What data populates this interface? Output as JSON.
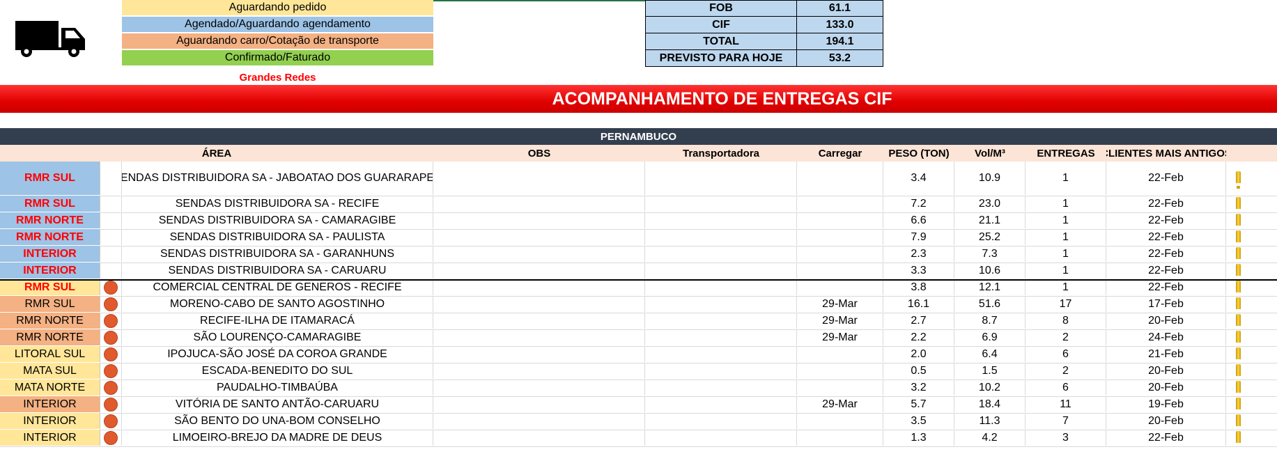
{
  "legend": [
    {
      "label": "Aguardando pedido",
      "color": "#ffe699"
    },
    {
      "label": "Agendado/Aguardando agendamento",
      "color": "#9dc3e6"
    },
    {
      "label": "Aguardando carro/Cotação de transporte",
      "color": "#f4b183"
    },
    {
      "label": "Confirmado/Faturado",
      "color": "#92d050"
    }
  ],
  "legend_note": "Grandes Redes",
  "summary": [
    {
      "label": "FOB",
      "value": "61.1"
    },
    {
      "label": "CIF",
      "value": "133.0"
    },
    {
      "label": "TOTAL",
      "value": "194.1"
    },
    {
      "label": "PREVISTO PARA HOJE",
      "value": "53.2"
    }
  ],
  "title": "ACOMPANHAMENTO DE ENTREGAS CIF",
  "region": "PERNAMBUCO",
  "headers": {
    "area": "ÁREA",
    "obs": "OBS",
    "transportadora": "Transportadora",
    "carregar": "Carregar",
    "peso": "PESO (TON)",
    "vol": "Vol/M³",
    "entregas": "ENTREGAS",
    "clientes": "CLIENTES MAIS ANTIGOS"
  },
  "rows": [
    {
      "area": "RMR SUL",
      "area_color": "#9dc3e6",
      "area_text_color": "#ff0000",
      "bold": true,
      "dot": false,
      "client": "SENDAS DISTRIBUIDORA SA - JABOATAO DOS GUARARAPES",
      "obs": "",
      "transportadora": "",
      "carregar": "",
      "peso": "3.4",
      "vol": "10.9",
      "entregas": "1",
      "data": "22-Feb"
    },
    {
      "area": "RMR SUL",
      "area_color": "#9dc3e6",
      "area_text_color": "#ff0000",
      "bold": true,
      "dot": false,
      "client": "SENDAS DISTRIBUIDORA SA - RECIFE",
      "obs": "",
      "transportadora": "",
      "carregar": "",
      "peso": "7.2",
      "vol": "23.0",
      "entregas": "1",
      "data": "22-Feb"
    },
    {
      "area": "RMR NORTE",
      "area_color": "#9dc3e6",
      "area_text_color": "#ff0000",
      "bold": true,
      "dot": false,
      "client": "SENDAS DISTRIBUIDORA SA - CAMARAGIBE",
      "obs": "",
      "transportadora": "",
      "carregar": "",
      "peso": "6.6",
      "vol": "21.1",
      "entregas": "1",
      "data": "22-Feb"
    },
    {
      "area": "RMR NORTE",
      "area_color": "#9dc3e6",
      "area_text_color": "#ff0000",
      "bold": true,
      "dot": false,
      "client": "SENDAS DISTRIBUIDORA SA - PAULISTA",
      "obs": "",
      "transportadora": "",
      "carregar": "",
      "peso": "7.9",
      "vol": "25.2",
      "entregas": "1",
      "data": "22-Feb"
    },
    {
      "area": "INTERIOR",
      "area_color": "#9dc3e6",
      "area_text_color": "#ff0000",
      "bold": true,
      "dot": false,
      "client": "SENDAS DISTRIBUIDORA SA - GARANHUNS",
      "obs": "",
      "transportadora": "",
      "carregar": "",
      "peso": "2.3",
      "vol": "7.3",
      "entregas": "1",
      "data": "22-Feb"
    },
    {
      "area": "INTERIOR",
      "area_color": "#9dc3e6",
      "area_text_color": "#ff0000",
      "bold": true,
      "dot": false,
      "client": "SENDAS DISTRIBUIDORA SA - CARUARU",
      "obs": "",
      "transportadora": "",
      "carregar": "",
      "peso": "3.3",
      "vol": "10.6",
      "entregas": "1",
      "data": "22-Feb"
    },
    {
      "area": "RMR SUL",
      "area_color": "#ffe699",
      "area_text_color": "#ff0000",
      "bold": true,
      "dot": true,
      "client": "COMERCIAL CENTRAL DE GENEROS - RECIFE",
      "obs": "",
      "transportadora": "",
      "carregar": "",
      "peso": "3.8",
      "vol": "12.1",
      "entregas": "1",
      "data": "22-Feb"
    },
    {
      "area": "RMR SUL",
      "area_color": "#f4b183",
      "area_text_color": "#000000",
      "bold": false,
      "dot": true,
      "client": "MORENO-CABO DE SANTO AGOSTINHO",
      "obs": "",
      "transportadora": "",
      "carregar": "29-Mar",
      "peso": "16.1",
      "vol": "51.6",
      "entregas": "17",
      "data": "17-Feb"
    },
    {
      "area": "RMR NORTE",
      "area_color": "#f4b183",
      "area_text_color": "#000000",
      "bold": false,
      "dot": true,
      "client": "RECIFE-ILHA DE ITAMARACÁ",
      "obs": "",
      "transportadora": "",
      "carregar": "29-Mar",
      "peso": "2.7",
      "vol": "8.7",
      "entregas": "8",
      "data": "20-Feb"
    },
    {
      "area": "RMR NORTE",
      "area_color": "#f4b183",
      "area_text_color": "#000000",
      "bold": false,
      "dot": true,
      "client": "SÃO LOURENÇO-CAMARAGIBE",
      "obs": "",
      "transportadora": "",
      "carregar": "29-Mar",
      "peso": "2.2",
      "vol": "6.9",
      "entregas": "2",
      "data": "24-Feb"
    },
    {
      "area": "LITORAL SUL",
      "area_color": "#ffe699",
      "area_text_color": "#000000",
      "bold": false,
      "dot": true,
      "client": "IPOJUCA-SÃO JOSÉ DA COROA GRANDE",
      "obs": "",
      "transportadora": "",
      "carregar": "",
      "peso": "2.0",
      "vol": "6.4",
      "entregas": "6",
      "data": "21-Feb"
    },
    {
      "area": "MATA SUL",
      "area_color": "#ffe699",
      "area_text_color": "#000000",
      "bold": false,
      "dot": true,
      "client": "ESCADA-BENEDITO DO SUL",
      "obs": "",
      "transportadora": "",
      "carregar": "",
      "peso": "0.5",
      "vol": "1.5",
      "entregas": "2",
      "data": "20-Feb"
    },
    {
      "area": "MATA NORTE",
      "area_color": "#ffe699",
      "area_text_color": "#000000",
      "bold": false,
      "dot": true,
      "client": "PAUDALHO-TIMBAÚBA",
      "obs": "",
      "transportadora": "",
      "carregar": "",
      "peso": "3.2",
      "vol": "10.2",
      "entregas": "6",
      "data": "20-Feb"
    },
    {
      "area": "INTERIOR",
      "area_color": "#f4b183",
      "area_text_color": "#000000",
      "bold": false,
      "dot": true,
      "client": "VITÓRIA DE SANTO ANTÃO-CARUARU",
      "obs": "",
      "transportadora": "",
      "carregar": "29-Mar",
      "peso": "5.7",
      "vol": "18.4",
      "entregas": "11",
      "data": "19-Feb"
    },
    {
      "area": "INTERIOR",
      "area_color": "#ffe699",
      "area_text_color": "#000000",
      "bold": false,
      "dot": true,
      "client": "SÃO BENTO DO UNA-BOM CONSELHO",
      "obs": "",
      "transportadora": "",
      "carregar": "",
      "peso": "3.5",
      "vol": "11.3",
      "entregas": "7",
      "data": "20-Feb"
    },
    {
      "area": "INTERIOR",
      "area_color": "#ffe699",
      "area_text_color": "#000000",
      "bold": false,
      "dot": true,
      "client": "LIMOEIRO-BREJO DA MADRE DE DEUS",
      "obs": "",
      "transportadora": "",
      "carregar": "",
      "peso": "1.3",
      "vol": "4.2",
      "entregas": "3",
      "data": "22-Feb"
    }
  ]
}
